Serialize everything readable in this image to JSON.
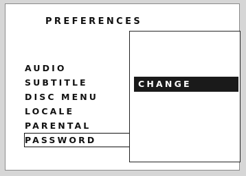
{
  "screen": {
    "title": "PREFERENCES"
  },
  "menu": {
    "items": [
      {
        "label": "AUDIO"
      },
      {
        "label": "SUBTITLE"
      },
      {
        "label": "DISC MENU"
      },
      {
        "label": "LOCALE"
      },
      {
        "label": "PARENTAL"
      },
      {
        "label": "PASSWORD"
      }
    ],
    "selected": "PASSWORD"
  },
  "submenu": {
    "items": [
      {
        "label": "CHANGE"
      }
    ],
    "highlighted": "CHANGE"
  }
}
